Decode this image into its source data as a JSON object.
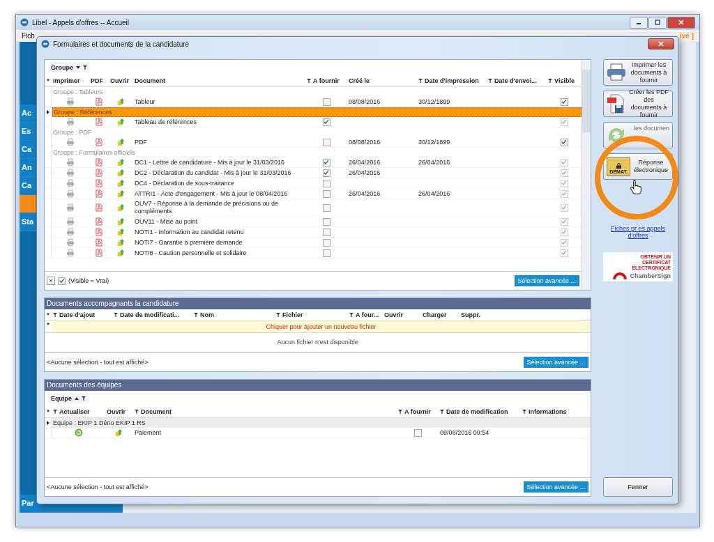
{
  "main_window": {
    "title": "Libel - Appels d'offres -- Accueil",
    "menu": [
      "Fich"
    ],
    "status_text": "ivé ]",
    "sidebar": [
      {
        "label": "Ac",
        "selected": false
      },
      {
        "label": "Es",
        "selected": false
      },
      {
        "label": "Ca",
        "selected": false
      },
      {
        "label": "An",
        "selected": false
      },
      {
        "label": "Ca",
        "selected": false
      },
      {
        "selected": true
      },
      {
        "label": "Sta",
        "selected": false
      }
    ],
    "sidebar_bottom": "Par"
  },
  "dialog": {
    "title": "Formulaires et documents de la candidature",
    "documents": {
      "group_by": "Groupe",
      "marker": "*",
      "columns": [
        {
          "label": "Imprimer",
          "filter_icon": false
        },
        {
          "label": "PDF",
          "filter_icon": false
        },
        {
          "label": "Ouvrir",
          "filter_icon": false
        },
        {
          "label": "Document",
          "filter_icon": false
        },
        {
          "label": "A fournir",
          "filter_icon": true
        },
        {
          "label": "Créé le",
          "filter_icon": false
        },
        {
          "label": "Date d'impression",
          "filter_icon": true
        },
        {
          "label": "Date d'envoi...",
          "filter_icon": true
        },
        {
          "label": "Visible",
          "filter_icon": true
        }
      ],
      "groups": [
        {
          "label": "Groupe : Tableurs",
          "selected": false,
          "rows": [
            {
              "document": "Tableur",
              "a_fournir": false,
              "created": "08/08/2016",
              "printed": "30/12/1899",
              "visible": true,
              "visible_disabled": false
            }
          ]
        },
        {
          "label": "Groupe : Références",
          "selected": true,
          "rows": [
            {
              "document": "Tableau de références",
              "a_fournir": true,
              "visible": true,
              "visible_disabled": true
            }
          ]
        },
        {
          "label": "Groupe : PDF",
          "selected": false,
          "rows": [
            {
              "document": "PDF",
              "a_fournir": false,
              "created": "08/08/2016",
              "printed": "30/12/1899",
              "visible": true,
              "visible_disabled": false
            }
          ]
        },
        {
          "label": "Groupe : Formulaires officiels",
          "selected": false,
          "rows": [
            {
              "document": "DC1 - Lettre de candidature - Mis à jour le 31/03/2016",
              "a_fournir": true,
              "created": "26/04/2016",
              "printed": "26/04/2016",
              "visible": true,
              "visible_disabled": true
            },
            {
              "document": "DC2 - Déclaration du candidat - Mis à jour le 31/03/2016",
              "a_fournir": true,
              "created": "26/04/2016",
              "visible": true,
              "visible_disabled": true
            },
            {
              "document": "DC4 - Déclaration de sous-traitance",
              "a_fournir": false,
              "visible": true,
              "visible_disabled": true
            },
            {
              "document": "ATTRI1 - Acte d'engagement - Mis à jour le 08/04/2016",
              "a_fournir": false,
              "created": "26/04/2016",
              "printed": "26/04/2016",
              "visible": true,
              "visible_disabled": true
            },
            {
              "document": "OUV7 - Réponse à la demande de précisions ou de compléments",
              "a_fournir": false,
              "visible": true,
              "visible_disabled": true
            },
            {
              "document": "OUV11 - Mise au point",
              "a_fournir": false,
              "visible": true,
              "visible_disabled": true
            },
            {
              "document": "NOTI1 - Information au candidat retenu",
              "a_fournir": false,
              "visible": true,
              "visible_disabled": true
            },
            {
              "document": "NOTI7 - Garantie à première demande",
              "a_fournir": false,
              "visible": true,
              "visible_disabled": true
            },
            {
              "document": "NOTI8 - Caution personnelle et solidaire",
              "a_fournir": false,
              "visible": true,
              "visible_disabled": true
            }
          ]
        }
      ],
      "filter": {
        "clear": "×",
        "enabled": true,
        "text": "(Visible = Vrai)"
      },
      "advanced_button": "Sélection avancée ..."
    },
    "attachments": {
      "title": "Documents accompagnants la candidature",
      "marker": "*",
      "columns": [
        {
          "label": "Date d'ajout",
          "filter_icon": true
        },
        {
          "label": "Date de modificati...",
          "filter_icon": true
        },
        {
          "label": "Nom",
          "filter_icon": true
        },
        {
          "label": "Fichier",
          "filter_icon": true
        },
        {
          "label": "A four...",
          "filter_icon": true
        },
        {
          "label": "Ouvrir",
          "filter_icon": false
        },
        {
          "label": "Charger",
          "filter_icon": false
        },
        {
          "label": "Suppr.",
          "filter_icon": false
        }
      ],
      "new_row": "Chiquer pour ajouter un nouveau fichier",
      "empty_text": "Aucun fichier n'est disponible",
      "selection_text": "<Aucune sélection - tout est affiché>",
      "advanced_button": "Sélection avancée ..."
    },
    "teams": {
      "title": "Documents des équipes",
      "group_by": "Equipe",
      "marker": "*",
      "columns": [
        {
          "label": "Actualiser",
          "filter_icon": true
        },
        {
          "label": "Ouvrir",
          "filter_icon": false
        },
        {
          "label": "Document",
          "filter_icon": true
        },
        {
          "label": "A fournir",
          "filter_icon": true
        },
        {
          "label": "Date de modification",
          "filter_icon": true
        },
        {
          "label": "Informations",
          "filter_icon": true
        }
      ],
      "groups": [
        {
          "label": "Equipe : EKIP 1 Déno EKIP 1 RS",
          "rows": [
            {
              "document": "Paiement",
              "a_fournir": false,
              "modified": "09/08/2016 09:54"
            }
          ]
        }
      ],
      "selection_text": "<Aucune sélection - tout est affiché>",
      "advanced_button": "Sélection avancée ..."
    },
    "actions": [
      {
        "kind": "print",
        "label": "Imprimer les documents à fournir"
      },
      {
        "kind": "pdf",
        "label": "Créer les PDF des documents à fournir"
      },
      {
        "kind": "refresh",
        "label": "les documen"
      },
      {
        "kind": "demat",
        "label": "Réponse électronique",
        "badge": "DÉMAT."
      }
    ],
    "link": "Fiches pr es appels d'offres",
    "certificate": {
      "headline": "OBTENIR UN CERTIFICAT ÉLECTRONIQUE",
      "brand": "ChamberSign"
    },
    "close_button": "Fermer"
  }
}
